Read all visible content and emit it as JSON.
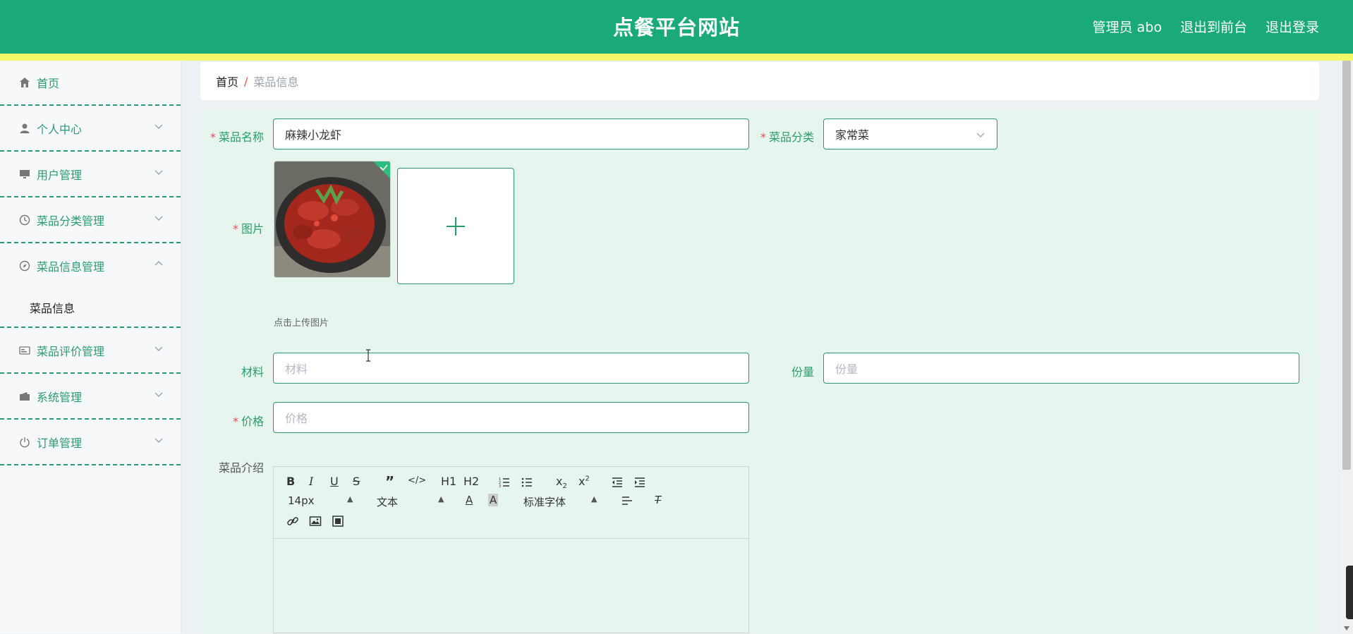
{
  "header": {
    "title": "点餐平台网站",
    "admin_label": "管理员 abo",
    "back_to_front": "退出到前台",
    "logout": "退出登录"
  },
  "sidebar": {
    "items": [
      {
        "label": "首页",
        "icon": "home-icon"
      },
      {
        "label": "个人中心",
        "icon": "user-icon"
      },
      {
        "label": "用户管理",
        "icon": "monitor-icon"
      },
      {
        "label": "菜品分类管理",
        "icon": "clock-icon"
      },
      {
        "label": "菜品信息管理",
        "icon": "compass-icon"
      },
      {
        "label": "菜品评价管理",
        "icon": "card-icon"
      },
      {
        "label": "系统管理",
        "icon": "wallet-icon"
      },
      {
        "label": "订单管理",
        "icon": "power-icon"
      }
    ],
    "submenu": {
      "label": "菜品信息"
    }
  },
  "breadcrumb": {
    "home": "首页",
    "separator": "/",
    "current": "菜品信息"
  },
  "form": {
    "name_label": "菜品名称",
    "name_value": "麻辣小龙虾",
    "category_label": "菜品分类",
    "category_value": "家常菜",
    "image_label": "图片",
    "upload_tip": "点击上传图片",
    "material_label": "材料",
    "material_placeholder": "材料",
    "portion_label": "份量",
    "portion_placeholder": "份量",
    "price_label": "价格",
    "price_placeholder": "价格",
    "intro_label": "菜品介绍",
    "required_mark": "*"
  },
  "editor": {
    "font_size": "14px",
    "header_select": "文本",
    "font_family": "标准字体",
    "h1": "H1",
    "h2": "H2"
  },
  "colors": {
    "primary": "#1aaa78",
    "accent_stripe": "#f3f868",
    "required": "#e25252",
    "form_bg": "#e6f6ef"
  }
}
